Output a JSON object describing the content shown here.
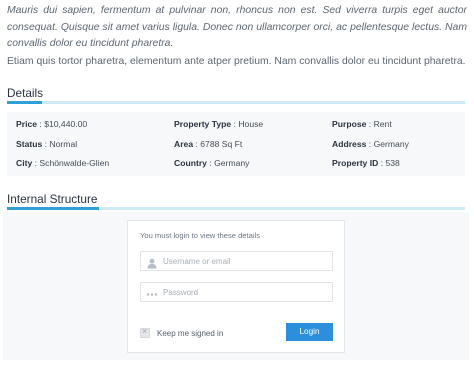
{
  "description": {
    "paragraph1": "Mauris dui sapien, fermentum at pulvinar non, rhoncus non est. Sed viverra turpis eget auctor consequat. Quisque sit amet varius ligula. Donec non ullamcorper orci, ac pellentesque lectus. Nam convallis dolor eu tincidunt pharetra.",
    "paragraph2": "Etiam quis tortor pharetra, elementum ante atper pretium. Nam convallis dolor eu tincidunt pharetra."
  },
  "details": {
    "title": "Details",
    "price": {
      "label": "Price",
      "value": "$10,440.00"
    },
    "property_type": {
      "label": "Property Type",
      "value": "House"
    },
    "purpose": {
      "label": "Purpose",
      "value": "Rent"
    },
    "status": {
      "label": "Status",
      "value": "Normal"
    },
    "area": {
      "label": "Area",
      "value": "6788 Sq Ft"
    },
    "address": {
      "label": "Address",
      "value": "Germany"
    },
    "city": {
      "label": "City",
      "value": "Schönwalde-Glien"
    },
    "country": {
      "label": "Country",
      "value": "Germany"
    },
    "property_id": {
      "label": "Property ID",
      "value": "538"
    }
  },
  "internal_structure": {
    "title": "Internal Structure",
    "login_note": "You must login to view these details",
    "username_placeholder": "Username or email",
    "password_placeholder": "Password",
    "keep_signed_in": "Keep me signed in",
    "login_button": "Login"
  },
  "colors": {
    "accent": "#2f9fd8",
    "accent_light": "#cfe9f5",
    "button": "#2b8fde"
  }
}
